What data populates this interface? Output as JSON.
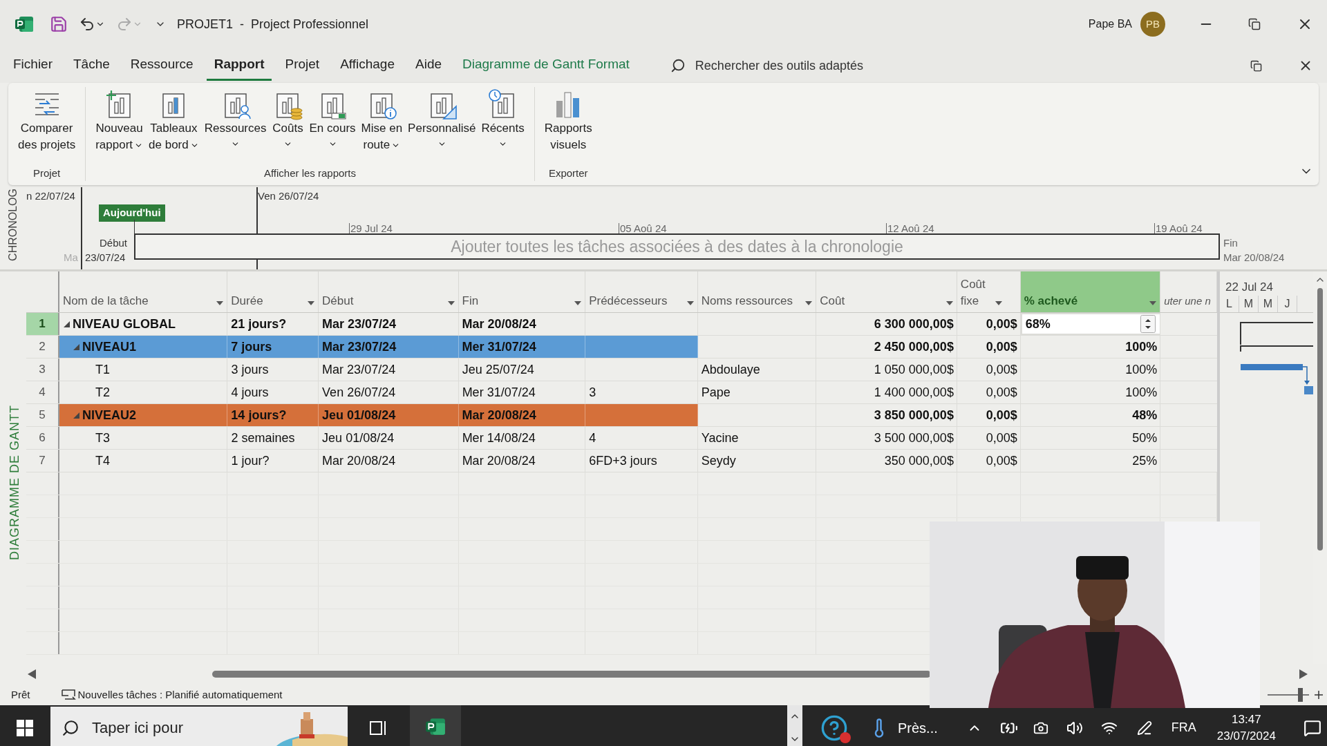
{
  "title_bar": {
    "title": "PROJET1  -  Project Professionnel",
    "user": "Pape BA",
    "avatar": "PB"
  },
  "menu_tabs": [
    {
      "label": "Fichier",
      "selected": false,
      "kind": "normal"
    },
    {
      "label": "Tâche",
      "selected": false,
      "kind": "normal"
    },
    {
      "label": "Ressource",
      "selected": false,
      "kind": "normal"
    },
    {
      "label": "Rapport",
      "selected": true,
      "kind": "normal"
    },
    {
      "label": "Projet",
      "selected": false,
      "kind": "normal"
    },
    {
      "label": "Affichage",
      "selected": false,
      "kind": "normal"
    },
    {
      "label": "Aide",
      "selected": false,
      "kind": "normal"
    },
    {
      "label": "Diagramme de Gantt Format",
      "selected": false,
      "kind": "contextual"
    }
  ],
  "search": {
    "placeholder": "Rechercher des outils adaptés"
  },
  "ribbon": {
    "groups": [
      {
        "label": "Projet",
        "buttons": [
          {
            "lines": [
              "Comparer",
              "des projets"
            ],
            "dropdown": false
          }
        ]
      },
      {
        "label": "Afficher les rapports",
        "buttons": [
          {
            "lines": [
              "Nouveau",
              "rapport"
            ],
            "dropdown": true
          },
          {
            "lines": [
              "Tableaux",
              "de bord"
            ],
            "dropdown": true
          },
          {
            "lines": [
              "Ressources"
            ],
            "dropdown": true
          },
          {
            "lines": [
              "Coûts"
            ],
            "dropdown": true
          },
          {
            "lines": [
              "En cours"
            ],
            "dropdown": true
          },
          {
            "lines": [
              "Mise en",
              "route"
            ],
            "dropdown": true
          },
          {
            "lines": [
              "Personnalisé"
            ],
            "dropdown": true
          },
          {
            "lines": [
              "Récents"
            ],
            "dropdown": true
          }
        ]
      },
      {
        "label": "Exporter",
        "buttons": [
          {
            "lines": [
              "Rapports",
              "visuels"
            ],
            "dropdown": false
          }
        ]
      }
    ]
  },
  "timeline": {
    "side_label": "CHRONOLOG",
    "left_date": "n 22/07/24",
    "marker_date": "Ven 26/07/24",
    "today_badge": "Aujourd'hui",
    "ticks": [
      "29 Jul 24",
      "05 Aoû 24",
      "12 Aoû 24",
      "19 Aoû 24"
    ],
    "start_label": "Début",
    "start_prefix": "Ma",
    "start_date": "23/07/24",
    "placeholder": "Ajouter toutes les tâches associées à des dates à la chronologie",
    "end_label": "Fin",
    "end_date": "Mar 20/08/24"
  },
  "gantt_view": {
    "side_label": "DIAGRAMME DE GANTT",
    "columns": [
      {
        "label": "Nom de la tâche",
        "filter": true,
        "selected": false
      },
      {
        "label": "Durée",
        "filter": true,
        "selected": false
      },
      {
        "label": "Début",
        "filter": true,
        "selected": false
      },
      {
        "label": "Fin",
        "filter": true,
        "selected": false
      },
      {
        "label": "Prédécesseurs",
        "filter": true,
        "selected": false
      },
      {
        "label": "Noms ressources",
        "filter": true,
        "selected": false
      },
      {
        "label": "Coût",
        "filter": true,
        "selected": false
      },
      {
        "label": "Coût fixe",
        "filter": true,
        "selected": false
      },
      {
        "label": "% achevé",
        "filter": true,
        "selected": true
      },
      {
        "label": "uter une n",
        "filter": false,
        "selected": false
      }
    ],
    "rows": [
      {
        "id": "1",
        "kind": "summary",
        "expanded": true,
        "selected": true,
        "name": "NIVEAU GLOBAL",
        "duration": "21 jours?",
        "start": "Mar 23/07/24",
        "finish": "Mar 20/08/24",
        "cost": "6 300 000,00$",
        "fixed_cost": "0,00$",
        "percent": "68%",
        "children": [
          {
            "id": "2",
            "kind": "summary",
            "expanded": true,
            "selected": false,
            "color": "#5b9bd5",
            "name": "NIVEAU1",
            "duration": "7 jours",
            "start": "Mar 23/07/24",
            "finish": "Mer 31/07/24",
            "cost": "2 450 000,00$",
            "fixed_cost": "0,00$",
            "percent": "100%",
            "children": [
              {
                "id": "3",
                "kind": "task",
                "selected": false,
                "name": "T1",
                "duration": "3 jours",
                "start": "Mar 23/07/24",
                "finish": "Jeu 25/07/24",
                "resources": "Abdoulaye",
                "cost": "1 050 000,00$",
                "fixed_cost": "0,00$",
                "percent": "100%"
              },
              {
                "id": "4",
                "kind": "task",
                "selected": false,
                "name": "T2",
                "duration": "4 jours",
                "start": "Ven 26/07/24",
                "finish": "Mer 31/07/24",
                "predecessors": "3",
                "resources": "Pape",
                "cost": "1 400 000,00$",
                "fixed_cost": "0,00$",
                "percent": "100%"
              }
            ]
          },
          {
            "id": "5",
            "kind": "summary",
            "expanded": true,
            "selected": false,
            "color": "#d5703a",
            "name": "NIVEAU2",
            "duration": "14 jours?",
            "start": "Jeu 01/08/24",
            "finish": "Mar 20/08/24",
            "cost": "3 850 000,00$",
            "fixed_cost": "0,00$",
            "percent": "48%",
            "children": [
              {
                "id": "6",
                "kind": "task",
                "selected": false,
                "name": "T3",
                "duration": "2 semaines",
                "start": "Jeu 01/08/24",
                "finish": "Mer 14/08/24",
                "predecessors": "4",
                "resources": "Yacine",
                "cost": "3 500 000,00$",
                "fixed_cost": "0,00$",
                "percent": "50%"
              },
              {
                "id": "7",
                "kind": "task",
                "selected": false,
                "name": "T4",
                "duration": "1 jour?",
                "start": "Mar 20/08/24",
                "finish": "Mar 20/08/24",
                "predecessors": "6FD+3 jours",
                "resources": "Seydy",
                "cost": "350 000,00$",
                "fixed_cost": "0,00$",
                "percent": "25%"
              }
            ]
          }
        ]
      }
    ],
    "chart_header": {
      "week": "22 Jul 24",
      "days": [
        "L",
        "M",
        "M",
        "J"
      ]
    }
  },
  "status_bar": {
    "state": "Prêt",
    "new_tasks": "Nouvelles tâches : Planifié automatiquement",
    "zoom": {
      "level": 0.8
    }
  },
  "taskbar": {
    "search_placeholder": "Taper ici pour",
    "widget": "Près...",
    "language": "FRA",
    "time": "13:47",
    "date": "23/07/2024"
  }
}
